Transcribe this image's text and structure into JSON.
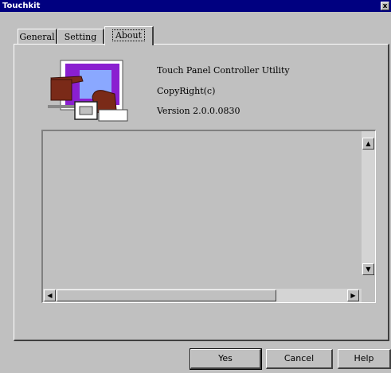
{
  "window": {
    "title": "Touchkit",
    "close_glyph": "x"
  },
  "tabs": [
    {
      "label": "General"
    },
    {
      "label": "Setting"
    },
    {
      "label": "About",
      "selected": true
    }
  ],
  "about": {
    "logo_icon": "touch-panel-hand-icon",
    "product": "Touch Panel Controller Utility",
    "copyright": "CopyRight(c)",
    "version": "Version 2.0.0.0830"
  },
  "scrollbars": {
    "up_glyph": "▲",
    "down_glyph": "▼",
    "left_glyph": "◀",
    "right_glyph": "▶"
  },
  "buttons": {
    "yes": "Yes",
    "cancel": "Cancel",
    "help": "Help"
  },
  "colors": {
    "titlebar": "#000080",
    "face": "#c0c0c0",
    "logo_purple": "#8a1fd0",
    "logo_hand": "#7a2a18",
    "logo_screen": "#8aa8ff"
  }
}
